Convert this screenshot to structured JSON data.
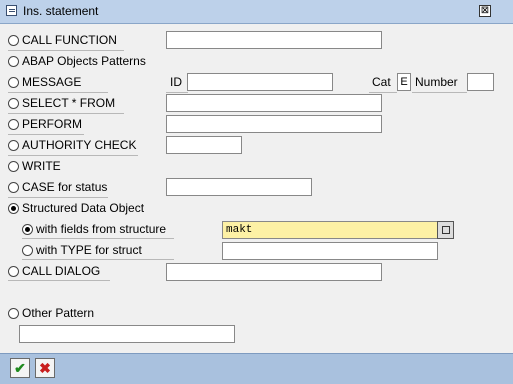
{
  "window": {
    "title": "Ins. statement",
    "close_symbol": "⊠"
  },
  "options": {
    "call_function": {
      "label": "CALL FUNCTION",
      "value": ""
    },
    "abap_objects": {
      "label": "ABAP Objects Patterns"
    },
    "message": {
      "label": "MESSAGE",
      "id_label": "ID",
      "id_value": "",
      "cat_label": "Cat",
      "cat_value": "E",
      "number_label": "Number",
      "number_value": ""
    },
    "select": {
      "label": "SELECT * FROM",
      "value": ""
    },
    "perform": {
      "label": "PERFORM",
      "value": ""
    },
    "authority": {
      "label": "AUTHORITY CHECK",
      "value": ""
    },
    "write": {
      "label": "WRITE"
    },
    "case": {
      "label": "CASE for status",
      "value": ""
    },
    "structured": {
      "label": "Structured Data Object",
      "selected": true
    },
    "with_fields": {
      "label": "with fields from structure",
      "value": "makt",
      "selected": true
    },
    "with_type": {
      "label": "with TYPE for struct",
      "value": ""
    },
    "call_dialog": {
      "label": "CALL DIALOG",
      "value": ""
    },
    "other": {
      "label": "Other Pattern",
      "value": ""
    }
  },
  "footer": {
    "ok_symbol": "✔",
    "cancel_symbol": "✖"
  },
  "colors": {
    "field_highlight": "#fdf1a5",
    "titlebar": "#bdd1ea",
    "footer": "#a9c1de"
  }
}
